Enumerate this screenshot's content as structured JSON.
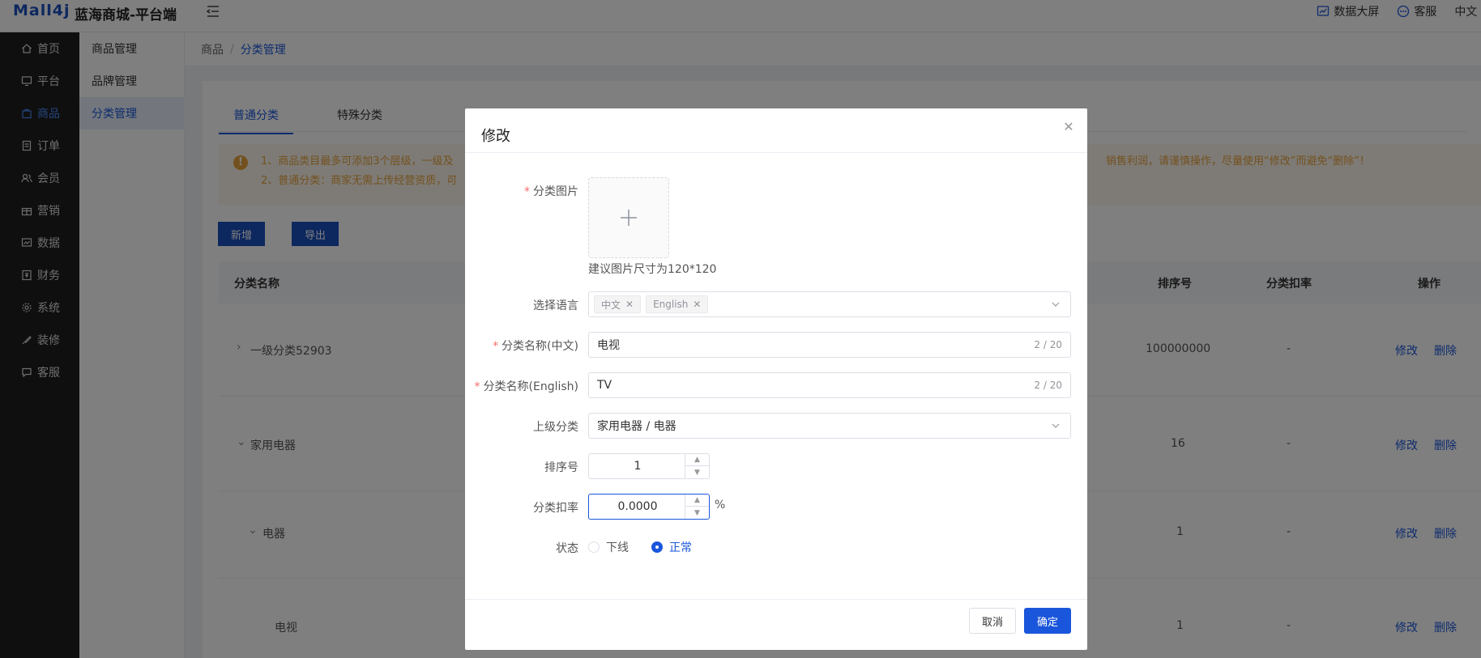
{
  "header": {
    "logo": "Mall4j",
    "site_title": "蓝海商城-平台端",
    "data_screen": "数据大屏",
    "customer_service": "客服",
    "language": "中文"
  },
  "sidebar": {
    "items": [
      {
        "label": "首页",
        "icon": "home-icon"
      },
      {
        "label": "平台",
        "icon": "monitor-icon"
      },
      {
        "label": "商品",
        "icon": "bag-icon"
      },
      {
        "label": "订单",
        "icon": "document-icon"
      },
      {
        "label": "会员",
        "icon": "users-icon"
      },
      {
        "label": "营销",
        "icon": "gift-icon"
      },
      {
        "label": "数据",
        "icon": "chart-icon"
      },
      {
        "label": "财务",
        "icon": "wallet-icon"
      },
      {
        "label": "系统",
        "icon": "gear-icon"
      },
      {
        "label": "装修",
        "icon": "brush-icon"
      },
      {
        "label": "客服",
        "icon": "chat-icon"
      }
    ],
    "active_index": 2
  },
  "submenu": {
    "items": [
      "商品管理",
      "品牌管理",
      "分类管理"
    ],
    "active_index": 2
  },
  "breadcrumb": {
    "root": "商品",
    "sep": "/",
    "current": "分类管理"
  },
  "tabs": [
    "普通分类",
    "特殊分类"
  ],
  "notice": {
    "line1": "1、商品类目最多可添加3个层级，一级及",
    "line1_right": "销售利润，请谨慎操作，尽量使用“修改”而避免“删除”！",
    "line2": "2、普通分类：商家无需上传经营资质，可"
  },
  "buttons": {
    "add": "新增",
    "export": "导出"
  },
  "table": {
    "headers": {
      "name": "分类名称",
      "sort": "排序号",
      "rate": "分类扣率",
      "ops": "操作"
    },
    "rows": [
      {
        "name": "一级分类52903",
        "sort": "100000000",
        "rate": "-",
        "edit": "修改",
        "delete": "删除"
      },
      {
        "name": "家用电器",
        "sort": "16",
        "rate": "-",
        "edit": "修改",
        "delete": "删除"
      },
      {
        "name": "电器",
        "sort": "1",
        "rate": "-",
        "edit": "修改",
        "delete": "删除"
      },
      {
        "name": "电视",
        "sort": "1",
        "rate": "-",
        "edit": "修改",
        "delete": "删除"
      }
    ]
  },
  "modal": {
    "title": "修改",
    "image_label": "分类图片",
    "image_tip": "建议图片尺寸为120*120",
    "language_label": "选择语言",
    "language_tags": [
      "中文",
      "English"
    ],
    "name_cn_label": "分类名称(中文)",
    "name_cn_value": "电视",
    "name_cn_count": "2 / 20",
    "name_en_label": "分类名称(English)",
    "name_en_value": "TV",
    "name_en_count": "2 / 20",
    "parent_label": "上级分类",
    "parent_value": "家用电器 / 电器",
    "sort_label": "排序号",
    "sort_value": "1",
    "rate_label": "分类扣率",
    "rate_value": "0.0000",
    "rate_unit": "%",
    "status_label": "状态",
    "status_offline": "下线",
    "status_normal": "正常",
    "cancel": "取消",
    "confirm": "确定"
  },
  "colors": {
    "primary": "#1a56db",
    "sidebar_bg": "#1f1f1f",
    "warning": "#e6a23c"
  }
}
